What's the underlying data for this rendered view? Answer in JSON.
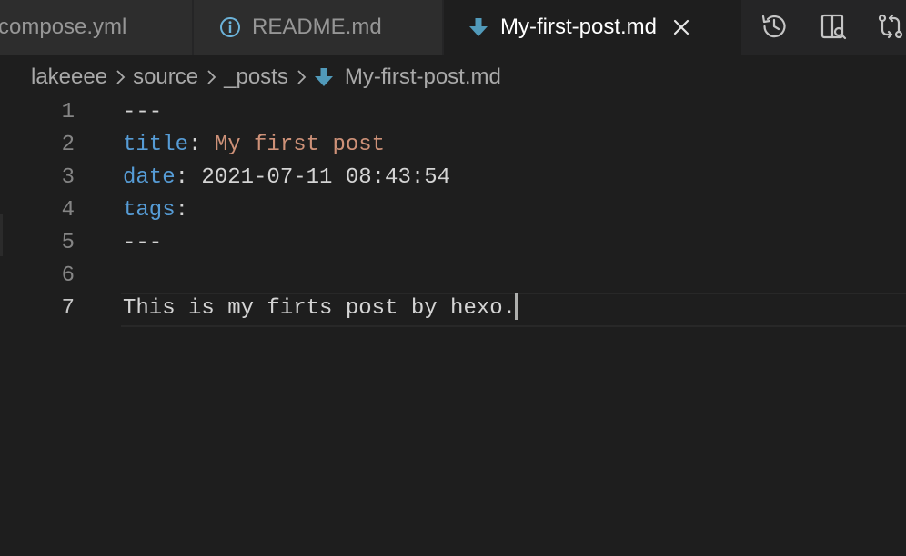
{
  "tabs": [
    {
      "label": "compose.yml",
      "active": false,
      "icon": "none"
    },
    {
      "label": "README.md",
      "active": false,
      "icon": "info-icon"
    },
    {
      "label": "My-first-post.md",
      "active": true,
      "icon": "markdown-arrow-icon"
    }
  ],
  "actions": [
    "history-icon",
    "split-editor-icon",
    "compare-changes-icon"
  ],
  "breadcrumb": {
    "items": [
      "lakeeee",
      "source",
      "_posts",
      "My-first-post.md"
    ]
  },
  "editor": {
    "lines": [
      {
        "number": "1",
        "dashes": "---"
      },
      {
        "number": "2",
        "key": "title",
        "colon": ":",
        "value": " My first post"
      },
      {
        "number": "3",
        "key": "date",
        "colon": ":",
        "value": " 2021-07-11 08:43:54"
      },
      {
        "number": "4",
        "key": "tags",
        "colon": ":"
      },
      {
        "number": "5",
        "dashes": "---"
      },
      {
        "number": "6"
      },
      {
        "number": "7",
        "text": "This is my firts post by hexo."
      }
    ],
    "current_line": 7
  },
  "colors": {
    "background": "#1e1e1e",
    "tabbar": "#252526",
    "inactive_tab": "#2d2d2d",
    "key": "#569cd6",
    "string": "#ce9178",
    "markdown_icon": "#519aba"
  }
}
